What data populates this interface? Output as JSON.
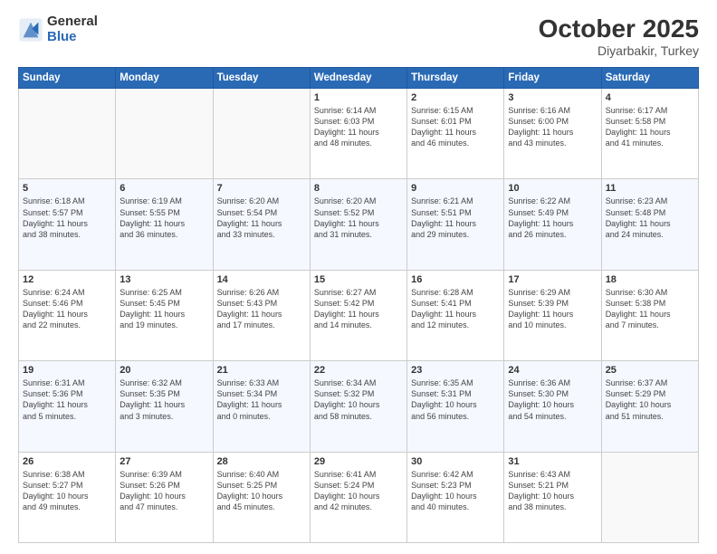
{
  "header": {
    "logo_general": "General",
    "logo_blue": "Blue",
    "month": "October 2025",
    "location": "Diyarbakir, Turkey"
  },
  "weekdays": [
    "Sunday",
    "Monday",
    "Tuesday",
    "Wednesday",
    "Thursday",
    "Friday",
    "Saturday"
  ],
  "weeks": [
    [
      {
        "day": "",
        "text": ""
      },
      {
        "day": "",
        "text": ""
      },
      {
        "day": "",
        "text": ""
      },
      {
        "day": "1",
        "text": "Sunrise: 6:14 AM\nSunset: 6:03 PM\nDaylight: 11 hours\nand 48 minutes."
      },
      {
        "day": "2",
        "text": "Sunrise: 6:15 AM\nSunset: 6:01 PM\nDaylight: 11 hours\nand 46 minutes."
      },
      {
        "day": "3",
        "text": "Sunrise: 6:16 AM\nSunset: 6:00 PM\nDaylight: 11 hours\nand 43 minutes."
      },
      {
        "day": "4",
        "text": "Sunrise: 6:17 AM\nSunset: 5:58 PM\nDaylight: 11 hours\nand 41 minutes."
      }
    ],
    [
      {
        "day": "5",
        "text": "Sunrise: 6:18 AM\nSunset: 5:57 PM\nDaylight: 11 hours\nand 38 minutes."
      },
      {
        "day": "6",
        "text": "Sunrise: 6:19 AM\nSunset: 5:55 PM\nDaylight: 11 hours\nand 36 minutes."
      },
      {
        "day": "7",
        "text": "Sunrise: 6:20 AM\nSunset: 5:54 PM\nDaylight: 11 hours\nand 33 minutes."
      },
      {
        "day": "8",
        "text": "Sunrise: 6:20 AM\nSunset: 5:52 PM\nDaylight: 11 hours\nand 31 minutes."
      },
      {
        "day": "9",
        "text": "Sunrise: 6:21 AM\nSunset: 5:51 PM\nDaylight: 11 hours\nand 29 minutes."
      },
      {
        "day": "10",
        "text": "Sunrise: 6:22 AM\nSunset: 5:49 PM\nDaylight: 11 hours\nand 26 minutes."
      },
      {
        "day": "11",
        "text": "Sunrise: 6:23 AM\nSunset: 5:48 PM\nDaylight: 11 hours\nand 24 minutes."
      }
    ],
    [
      {
        "day": "12",
        "text": "Sunrise: 6:24 AM\nSunset: 5:46 PM\nDaylight: 11 hours\nand 22 minutes."
      },
      {
        "day": "13",
        "text": "Sunrise: 6:25 AM\nSunset: 5:45 PM\nDaylight: 11 hours\nand 19 minutes."
      },
      {
        "day": "14",
        "text": "Sunrise: 6:26 AM\nSunset: 5:43 PM\nDaylight: 11 hours\nand 17 minutes."
      },
      {
        "day": "15",
        "text": "Sunrise: 6:27 AM\nSunset: 5:42 PM\nDaylight: 11 hours\nand 14 minutes."
      },
      {
        "day": "16",
        "text": "Sunrise: 6:28 AM\nSunset: 5:41 PM\nDaylight: 11 hours\nand 12 minutes."
      },
      {
        "day": "17",
        "text": "Sunrise: 6:29 AM\nSunset: 5:39 PM\nDaylight: 11 hours\nand 10 minutes."
      },
      {
        "day": "18",
        "text": "Sunrise: 6:30 AM\nSunset: 5:38 PM\nDaylight: 11 hours\nand 7 minutes."
      }
    ],
    [
      {
        "day": "19",
        "text": "Sunrise: 6:31 AM\nSunset: 5:36 PM\nDaylight: 11 hours\nand 5 minutes."
      },
      {
        "day": "20",
        "text": "Sunrise: 6:32 AM\nSunset: 5:35 PM\nDaylight: 11 hours\nand 3 minutes."
      },
      {
        "day": "21",
        "text": "Sunrise: 6:33 AM\nSunset: 5:34 PM\nDaylight: 11 hours\nand 0 minutes."
      },
      {
        "day": "22",
        "text": "Sunrise: 6:34 AM\nSunset: 5:32 PM\nDaylight: 10 hours\nand 58 minutes."
      },
      {
        "day": "23",
        "text": "Sunrise: 6:35 AM\nSunset: 5:31 PM\nDaylight: 10 hours\nand 56 minutes."
      },
      {
        "day": "24",
        "text": "Sunrise: 6:36 AM\nSunset: 5:30 PM\nDaylight: 10 hours\nand 54 minutes."
      },
      {
        "day": "25",
        "text": "Sunrise: 6:37 AM\nSunset: 5:29 PM\nDaylight: 10 hours\nand 51 minutes."
      }
    ],
    [
      {
        "day": "26",
        "text": "Sunrise: 6:38 AM\nSunset: 5:27 PM\nDaylight: 10 hours\nand 49 minutes."
      },
      {
        "day": "27",
        "text": "Sunrise: 6:39 AM\nSunset: 5:26 PM\nDaylight: 10 hours\nand 47 minutes."
      },
      {
        "day": "28",
        "text": "Sunrise: 6:40 AM\nSunset: 5:25 PM\nDaylight: 10 hours\nand 45 minutes."
      },
      {
        "day": "29",
        "text": "Sunrise: 6:41 AM\nSunset: 5:24 PM\nDaylight: 10 hours\nand 42 minutes."
      },
      {
        "day": "30",
        "text": "Sunrise: 6:42 AM\nSunset: 5:23 PM\nDaylight: 10 hours\nand 40 minutes."
      },
      {
        "day": "31",
        "text": "Sunrise: 6:43 AM\nSunset: 5:21 PM\nDaylight: 10 hours\nand 38 minutes."
      },
      {
        "day": "",
        "text": ""
      }
    ]
  ]
}
